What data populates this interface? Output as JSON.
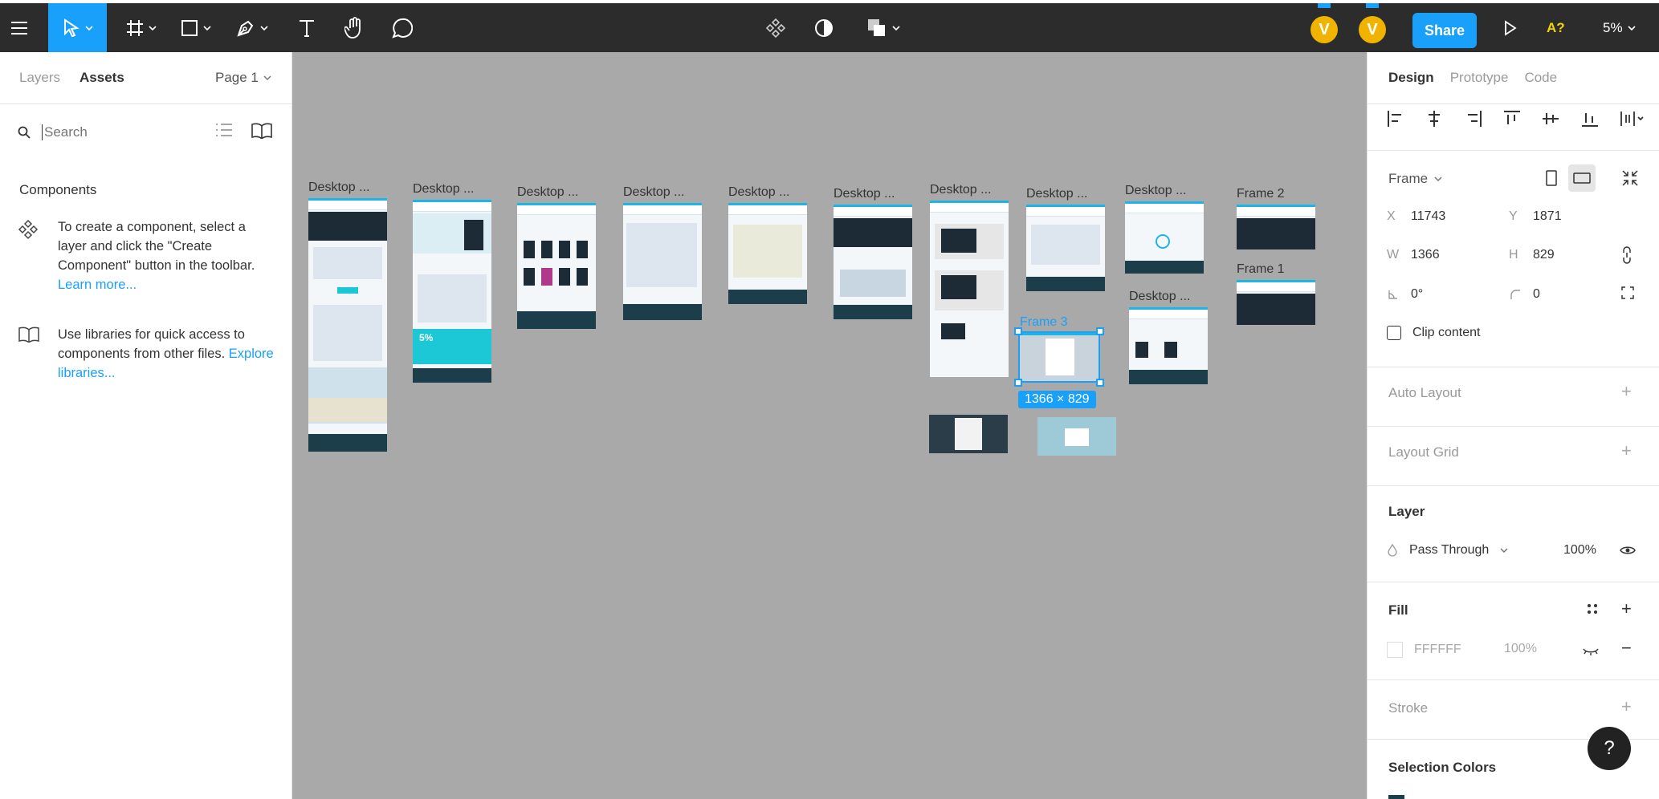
{
  "toolbar": {
    "share_label": "Share",
    "a_label": "A?",
    "zoom_label": "5%",
    "avatar1": "V",
    "avatar2": "V",
    "accent": "#18a0fb"
  },
  "left_panel": {
    "tabs": [
      "Layers",
      "Assets"
    ],
    "page": "Page 1",
    "search_placeholder": "Search",
    "components_title": "Components",
    "info1_text": "To create a component, select a layer and click the \"Create Component\" button in the toolbar.",
    "info1_link": "Learn more...",
    "info2_text": "Use libraries for quick access to components from other files.",
    "info2_link": "Explore libraries..."
  },
  "canvas": {
    "frames": [
      "Desktop ...",
      "Desktop ...",
      "Desktop ...",
      "Desktop ...",
      "Desktop ...",
      "Desktop ...",
      "Desktop ...",
      "Desktop ...",
      "Desktop ...",
      "Desktop ...",
      "Frame 2",
      "Frame 1",
      "Frame 3"
    ],
    "selection_size": "1366 × 829",
    "thumb_discount": "5%"
  },
  "right_panel": {
    "tabs": [
      "Design",
      "Prototype",
      "Code"
    ],
    "frame_select": "Frame",
    "x_label": "X",
    "x_value": "11743",
    "y_label": "Y",
    "y_value": "1871",
    "w_label": "W",
    "w_value": "1366",
    "h_label": "H",
    "h_value": "829",
    "rotation": "0°",
    "radius": "0",
    "clip_content": "Clip content",
    "auto_layout": "Auto Layout",
    "layout_grid": "Layout Grid",
    "layer": "Layer",
    "blend_mode": "Pass Through",
    "layer_opacity": "100%",
    "fill": "Fill",
    "fill_hex": "FFFFFF",
    "fill_opacity": "100%",
    "stroke": "Stroke",
    "selection_colors": "Selection Colors",
    "help": "?"
  }
}
